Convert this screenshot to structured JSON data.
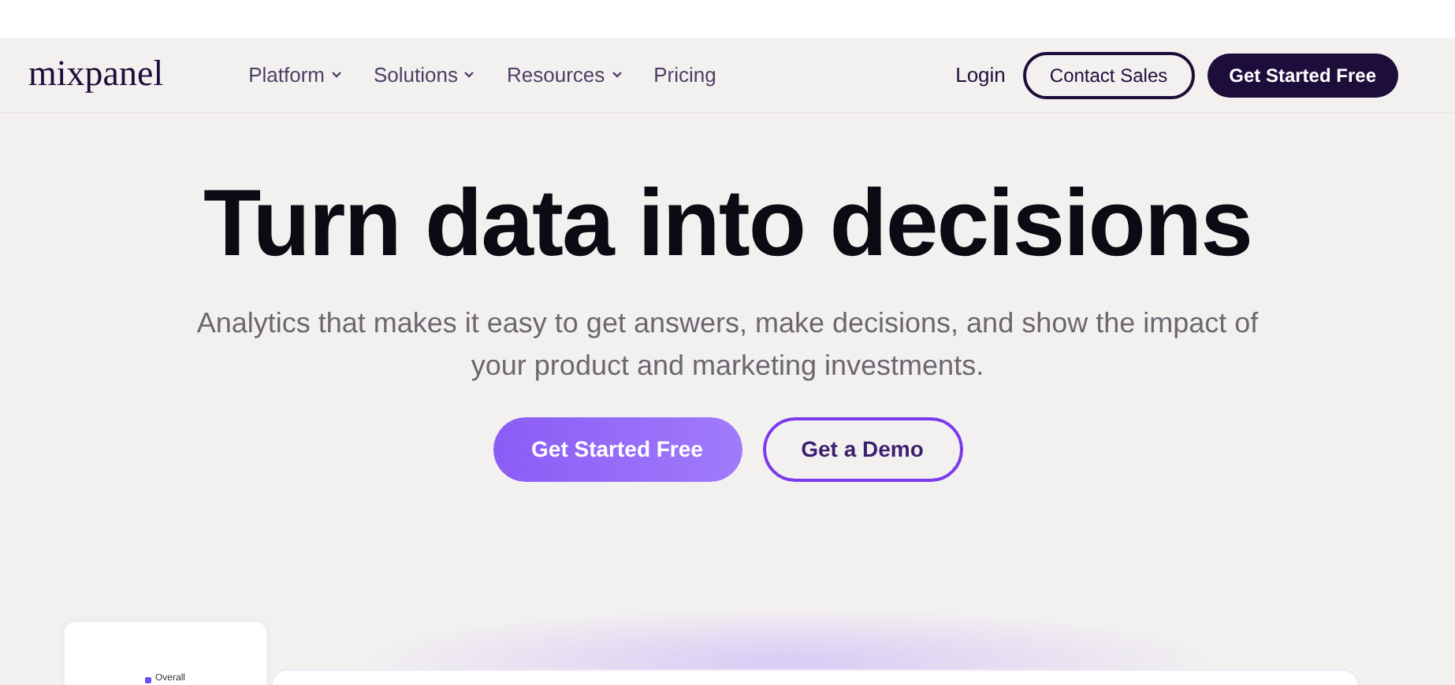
{
  "nav": {
    "logo": "mixpanel",
    "items": [
      {
        "label": "Platform",
        "dropdown": true
      },
      {
        "label": "Solutions",
        "dropdown": true
      },
      {
        "label": "Resources",
        "dropdown": true
      },
      {
        "label": "Pricing",
        "dropdown": false
      }
    ],
    "login": "Login",
    "contact": "Contact Sales",
    "cta": "Get Started Free"
  },
  "hero": {
    "title": "Turn data into decisions",
    "subtitle": "Analytics that makes it easy to get answers, make decisions, and show the impact of your product and marketing investments.",
    "primary": "Get Started Free",
    "secondary": "Get a Demo"
  },
  "preview": {
    "legend": "Overall"
  }
}
